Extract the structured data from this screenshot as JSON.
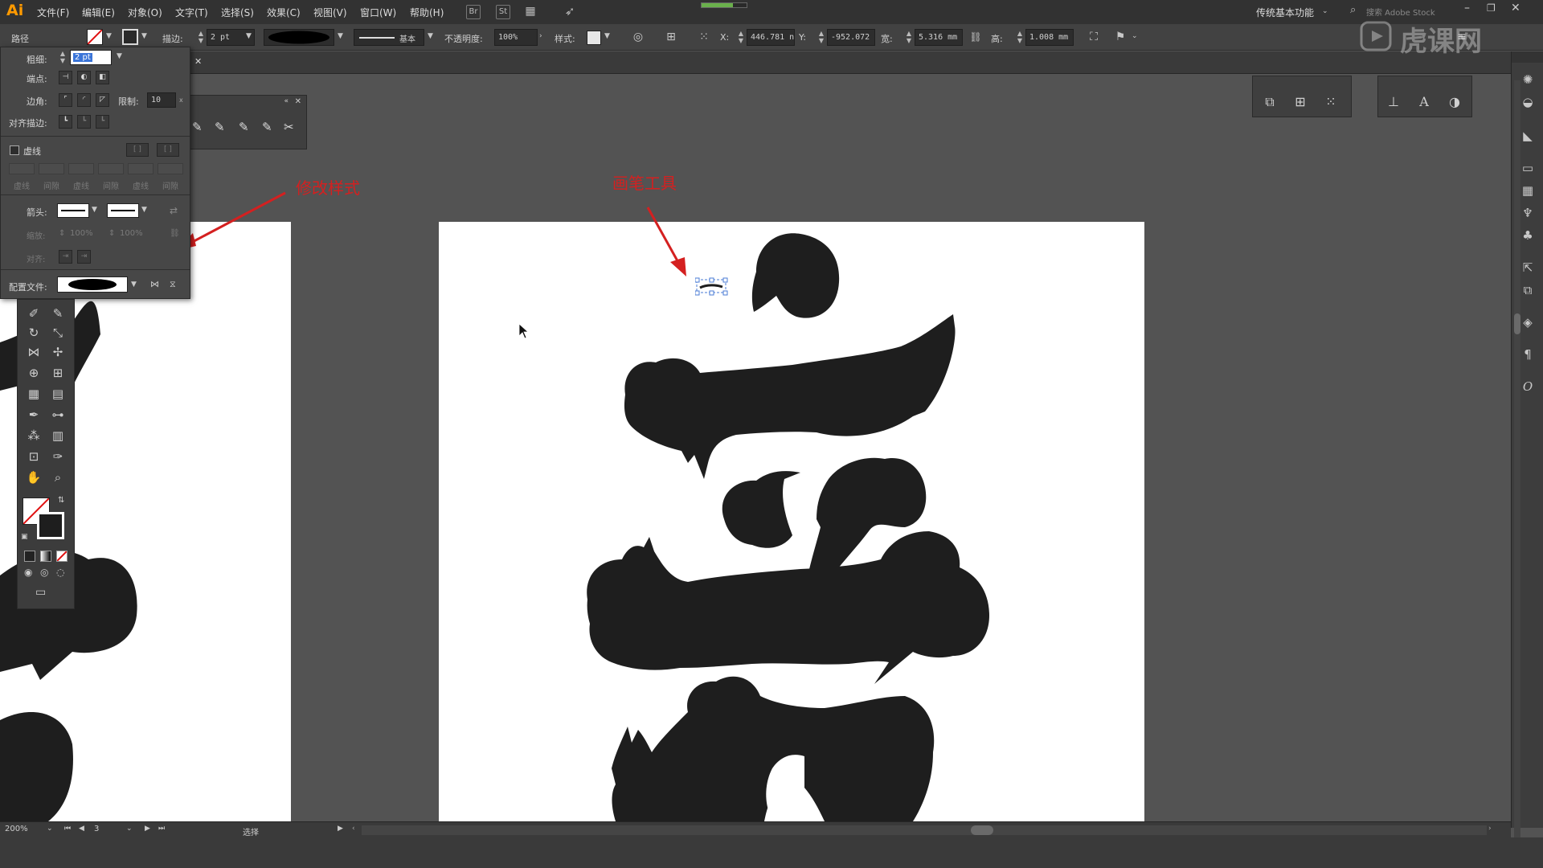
{
  "app": {
    "logo": "Ai",
    "workspace": "传统基本功能",
    "search_placeholder": "搜索 Adobe Stock",
    "br_label": "Br",
    "st_label": "St"
  },
  "menu": [
    "文件(F)",
    "编辑(E)",
    "对象(O)",
    "文字(T)",
    "选择(S)",
    "效果(C)",
    "视图(V)",
    "窗口(W)",
    "帮助(H)"
  ],
  "control": {
    "selection_type": "路径",
    "stroke_label": "描边:",
    "stroke_weight": "2 pt",
    "brush_label": "基本",
    "opacity_label": "不透明度:",
    "opacity_value": "100%",
    "style_label": "样式:",
    "x_label": "X:",
    "x_value": "446.781 n",
    "y_label": "Y:",
    "y_value": "-952.072",
    "w_label": "宽:",
    "w_value": "5.316 mm",
    "h_label": "高:",
    "h_value": "1.008 mm"
  },
  "stroke_panel": {
    "weight_label": "粗细:",
    "weight_value": "2 pt",
    "cap_label": "端点:",
    "corner_label": "边角:",
    "limit_label": "限制:",
    "limit_value": "10",
    "align_label": "对齐描边:",
    "dashed_label": "虚线",
    "dash_fields": [
      "虚线",
      "间隙",
      "虚线",
      "间隙",
      "虚线",
      "间隙"
    ],
    "arrow_label": "箭头:",
    "scale_label": "缩放:",
    "scale_a": "100%",
    "scale_b": "100%",
    "align2_label": "对齐:",
    "profile_label": "配置文件:"
  },
  "annotations": {
    "modify_style": "修改样式",
    "brush_tool": "画笔工具"
  },
  "statusbar": {
    "zoom": "200%",
    "page": "3",
    "tool": "选择"
  },
  "watermark": "虎课网",
  "colors": {
    "accent_red": "#d42020",
    "glyph": "#1e1e1e",
    "logo": "#ff9a00"
  }
}
